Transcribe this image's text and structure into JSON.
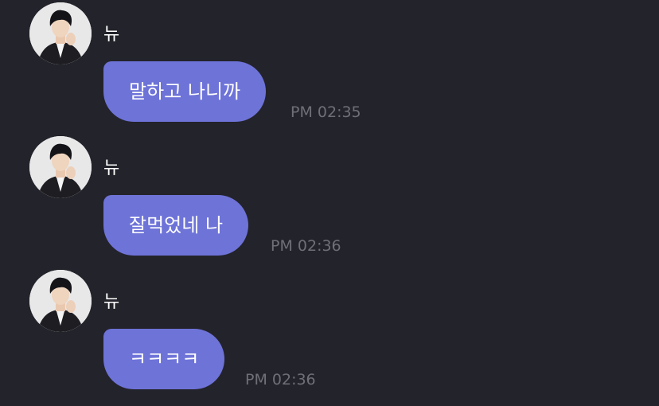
{
  "messages": [
    {
      "sender": "뉴",
      "text": "말하고 나니까",
      "time": "PM 02:35"
    },
    {
      "sender": "뉴",
      "text": "잘먹었네 나",
      "time": "PM 02:36"
    },
    {
      "sender": "뉴",
      "text": "ㅋㅋㅋㅋ",
      "time": "PM 02:36"
    }
  ],
  "colors": {
    "background": "#23232b",
    "bubble": "#6e73d8",
    "timestamp": "#6f6f78",
    "sender": "#ffffff"
  }
}
